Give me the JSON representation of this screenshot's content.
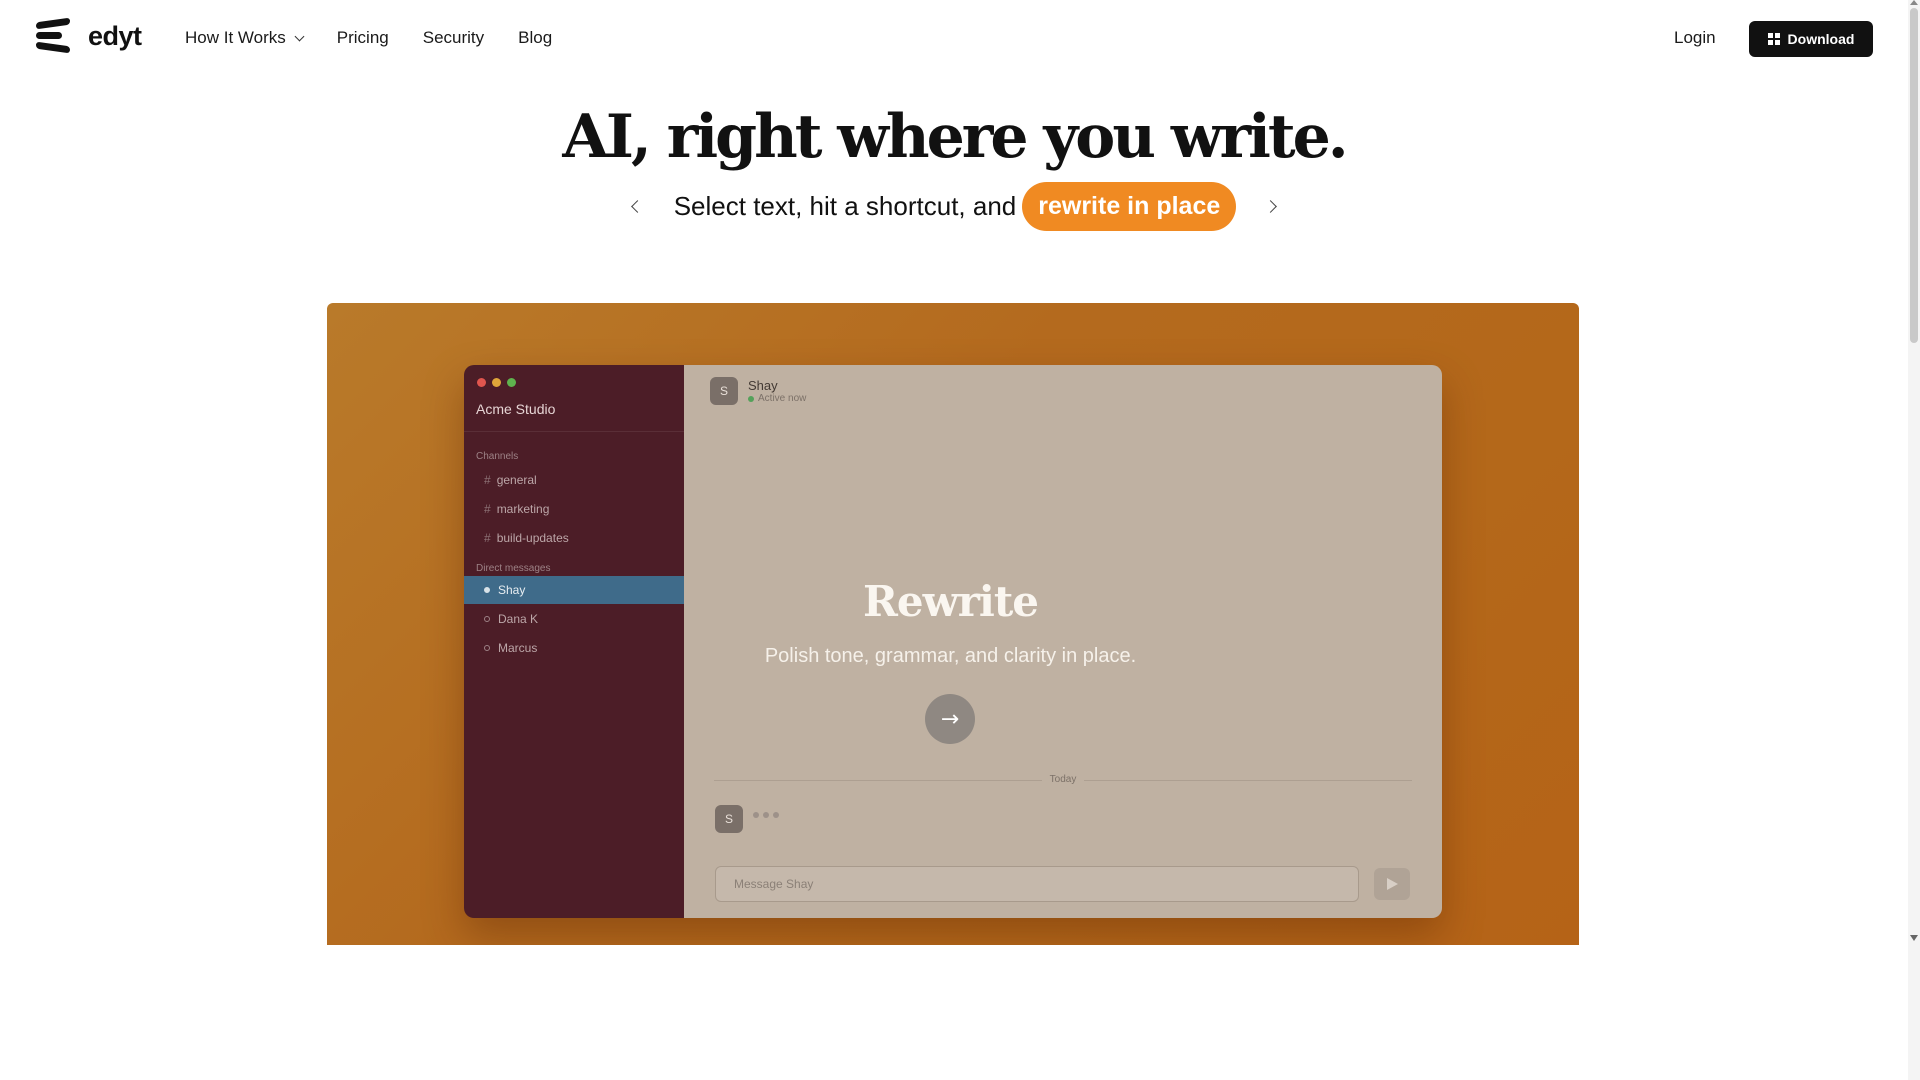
{
  "nav": {
    "brand": "edyt",
    "links": [
      "How It Works",
      "Pricing",
      "Security",
      "Blog"
    ],
    "login": "Login",
    "download": "Download"
  },
  "hero": {
    "title": "AI, right where you write.",
    "subtitle": "Select text, hit a shortcut, and",
    "highlight": "rewrite in place"
  },
  "app": {
    "workspace": "Acme Studio",
    "sections": {
      "channels": "Channels",
      "direct_messages": "Direct messages"
    },
    "channels": [
      "general",
      "marketing",
      "build-updates"
    ],
    "dms": [
      "Shay",
      "Dana K",
      "Marcus"
    ],
    "chat": {
      "name": "Shay",
      "status": "Active now",
      "avatar_letter": "S",
      "day": "Today",
      "composer_placeholder": "Message Shay"
    },
    "overlay": {
      "title": "Rewrite",
      "description": "Polish tone, grammar, and clarity in place."
    }
  },
  "colors": {
    "accent": "#f08a22",
    "showcase_bg": "#b46a1e",
    "sidebar_bg": "#4c1d27",
    "active_dm": "#3f6b8a"
  },
  "icons": [
    "logo-icon",
    "chevron-down-icon",
    "windows-icon",
    "chevron-left-icon",
    "chevron-right-icon",
    "arrow-right-icon",
    "send-icon"
  ]
}
